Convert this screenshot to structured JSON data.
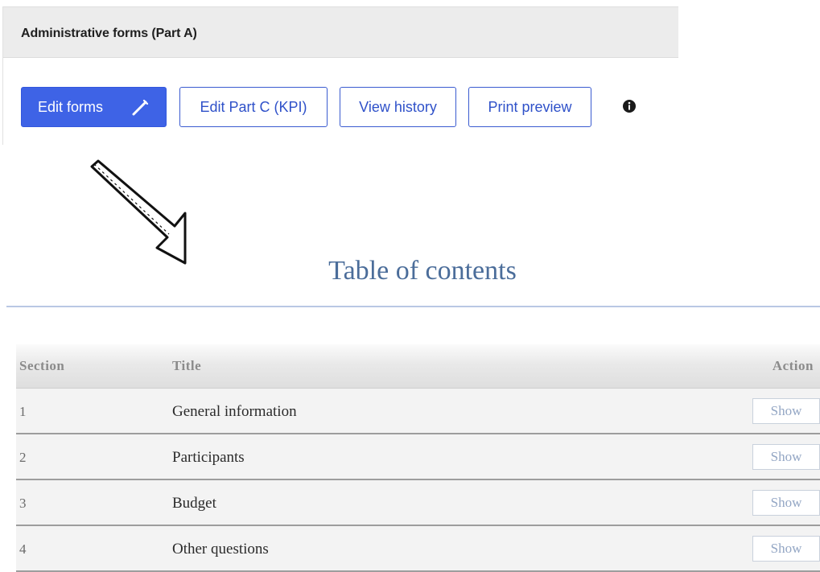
{
  "panel": {
    "title": "Administrative forms (Part A)",
    "buttons": {
      "edit_forms": "Edit forms",
      "edit_part_c": "Edit Part C (KPI)",
      "view_history": "View history",
      "print_preview": "Print preview"
    }
  },
  "toc": {
    "title": "Table of contents",
    "columns": {
      "section": "Section",
      "title": "Title",
      "action": "Action"
    },
    "rows": [
      {
        "section": "1",
        "title": "General information",
        "action": "Show"
      },
      {
        "section": "2",
        "title": "Participants",
        "action": "Show"
      },
      {
        "section": "3",
        "title": "Budget",
        "action": "Show"
      },
      {
        "section": "4",
        "title": "Other questions",
        "action": "Show"
      }
    ]
  },
  "colors": {
    "primary": "#3e63e6",
    "outline": "#3a5bd0",
    "toc_title": "#4b6d9a"
  },
  "icons": {
    "edit": "pencil-icon",
    "info": "info-icon",
    "annotation": "arrow-icon"
  }
}
